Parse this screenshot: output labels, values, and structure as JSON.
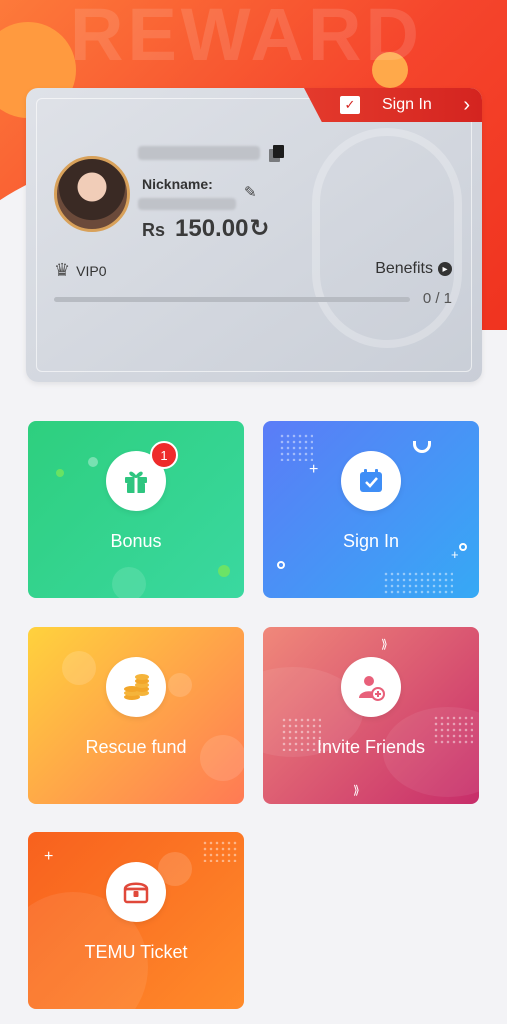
{
  "header": {
    "bg_word": "REWARD"
  },
  "profile": {
    "sign_in_label": "Sign In",
    "nickname_label": "Nickname:",
    "currency": "Rs",
    "balance": "150.00",
    "vip_label": "VIP0",
    "benefits_label": "Benefits",
    "progress_text": "0 / 1",
    "progress_fraction": 0
  },
  "tiles": [
    {
      "label": "Bonus",
      "badge": "1",
      "icon": "gift-icon",
      "colors": [
        "#2ecf7e",
        "#3ad8a0"
      ]
    },
    {
      "label": "Sign In",
      "icon": "calendar-check-icon",
      "colors": [
        "#5b7cf7",
        "#36a9f5"
      ]
    },
    {
      "label": "Rescue fund",
      "icon": "coins-icon",
      "colors": [
        "#ffd23d",
        "#ff7a54"
      ]
    },
    {
      "label": "Invite Friends",
      "icon": "add-user-icon",
      "colors": [
        "#f0887a",
        "#c72d6a"
      ]
    },
    {
      "label": "TEMU Ticket",
      "icon": "treasure-chest-icon",
      "colors": [
        "#f8611e",
        "#ff8b2a"
      ]
    }
  ],
  "colors": {
    "accent": "#e43a2c",
    "page_bg": "#f3f3f6"
  }
}
